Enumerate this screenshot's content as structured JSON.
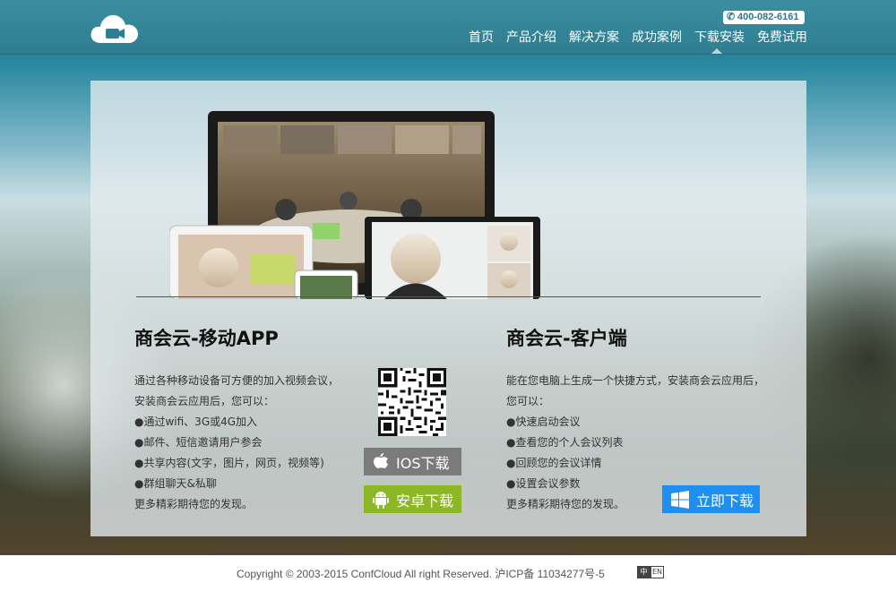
{
  "header": {
    "phone": "400-082-6161",
    "nav": [
      "首页",
      "产品介绍",
      "解决方案",
      "成功案例",
      "下载安装",
      "免费试用"
    ],
    "active_nav": "下载安装"
  },
  "mobile_app": {
    "title": "商会云-移动APP",
    "lines": [
      "通过各种移动设备可方便的加入视频会议，",
      "安装商会云应用后，您可以：",
      "●通过wifi、3G或4G加入",
      "●邮件、短信邀请用户参会",
      "●共享内容(文字，图片，网页，视频等)",
      "●群组聊天&私聊",
      "更多精彩期待您的发现。"
    ],
    "ios_button": "IOS下载",
    "android_button": "安卓下载"
  },
  "client": {
    "title": "商会云-客户端",
    "lines": [
      "能在您电脑上生成一个快捷方式，安装商会云应用后，",
      "您可以：",
      "●快速启动会议",
      "●查看您的个人会议列表",
      "●回顾您的会议详情",
      "●设置会议参数",
      "更多精彩期待您的发现。"
    ],
    "download_button": "立即下载"
  },
  "footer": {
    "copyright": "Copyright © 2003-2015 ConfCloud All right Reserved. 沪ICP备 11034277号-5",
    "lang_zh": "中",
    "lang_en": "EN"
  },
  "colors": {
    "header": "#2f7d91",
    "ios": "#7b7b7b",
    "android": "#8cb826",
    "windows": "#1e8ff0"
  }
}
